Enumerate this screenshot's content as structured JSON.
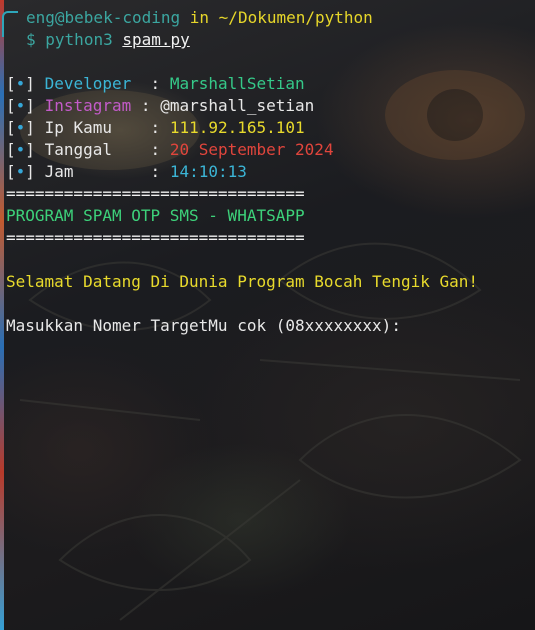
{
  "prompt": {
    "user_host": "eng@bebek-coding",
    "in_word": "in",
    "path": "~/Dokumen/python",
    "symbol": "$",
    "command": "python3",
    "file": "spam.py"
  },
  "info": [
    {
      "bracket_open": "[",
      "bullet": "•",
      "bracket_close": "]",
      "label": "Developer",
      "colon": ":",
      "value": "MarshallSetian"
    },
    {
      "bracket_open": "[",
      "bullet": "•",
      "bracket_close": "]",
      "label": "Instagram",
      "colon": ":",
      "value": "@marshall_setian"
    },
    {
      "bracket_open": "[",
      "bullet": "•",
      "bracket_close": "]",
      "label": "Ip Kamu",
      "colon": ":",
      "value": "111.92.165.101"
    },
    {
      "bracket_open": "[",
      "bullet": "•",
      "bracket_close": "]",
      "label": "Tanggal",
      "colon": ":",
      "value": "20 September 2024"
    },
    {
      "bracket_open": "[",
      "bullet": "•",
      "bracket_close": "]",
      "label": "Jam",
      "colon": ":",
      "value": "14:10:13"
    }
  ],
  "separator": "===============================",
  "program_title": "PROGRAM SPAM OTP SMS - WHATSAPP",
  "welcome": "Selamat Datang Di Dunia Program Bocah Tengik Gan!",
  "input_prompt": "Masukkan Nomer TargetMu cok (08xxxxxxxx):",
  "colors": {
    "background": "#15171c",
    "user": "#3ba6a0",
    "path": "#e6d62a",
    "bullet": "#35a7d8",
    "developer": "#3bb5d6",
    "instagram": "#c35bc9",
    "ip": "#e8da2c",
    "date": "#e0453c",
    "time": "#3bb5d6",
    "title": "#3dd17a",
    "welcome": "#e8da2c"
  }
}
